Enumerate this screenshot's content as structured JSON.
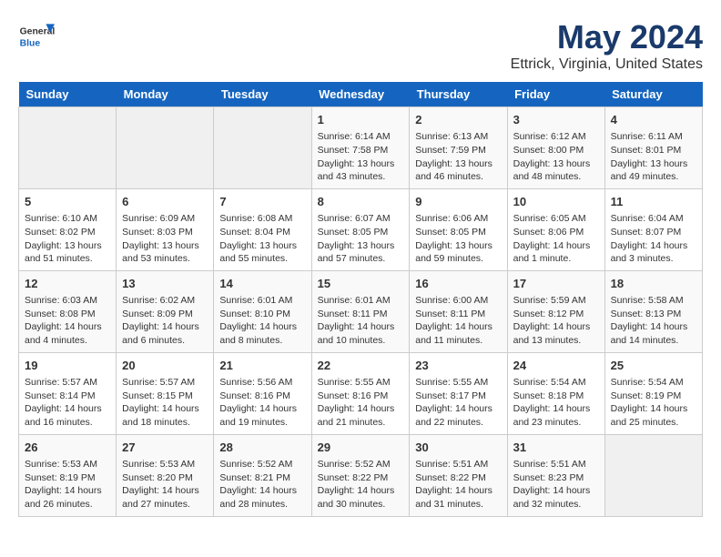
{
  "header": {
    "logo_general": "General",
    "logo_blue": "Blue",
    "month_year": "May 2024",
    "location": "Ettrick, Virginia, United States"
  },
  "days_of_week": [
    "Sunday",
    "Monday",
    "Tuesday",
    "Wednesday",
    "Thursday",
    "Friday",
    "Saturday"
  ],
  "weeks": [
    [
      {
        "day": "",
        "info": ""
      },
      {
        "day": "",
        "info": ""
      },
      {
        "day": "",
        "info": ""
      },
      {
        "day": "1",
        "info": "Sunrise: 6:14 AM\nSunset: 7:58 PM\nDaylight: 13 hours\nand 43 minutes."
      },
      {
        "day": "2",
        "info": "Sunrise: 6:13 AM\nSunset: 7:59 PM\nDaylight: 13 hours\nand 46 minutes."
      },
      {
        "day": "3",
        "info": "Sunrise: 6:12 AM\nSunset: 8:00 PM\nDaylight: 13 hours\nand 48 minutes."
      },
      {
        "day": "4",
        "info": "Sunrise: 6:11 AM\nSunset: 8:01 PM\nDaylight: 13 hours\nand 49 minutes."
      }
    ],
    [
      {
        "day": "5",
        "info": "Sunrise: 6:10 AM\nSunset: 8:02 PM\nDaylight: 13 hours\nand 51 minutes."
      },
      {
        "day": "6",
        "info": "Sunrise: 6:09 AM\nSunset: 8:03 PM\nDaylight: 13 hours\nand 53 minutes."
      },
      {
        "day": "7",
        "info": "Sunrise: 6:08 AM\nSunset: 8:04 PM\nDaylight: 13 hours\nand 55 minutes."
      },
      {
        "day": "8",
        "info": "Sunrise: 6:07 AM\nSunset: 8:05 PM\nDaylight: 13 hours\nand 57 minutes."
      },
      {
        "day": "9",
        "info": "Sunrise: 6:06 AM\nSunset: 8:05 PM\nDaylight: 13 hours\nand 59 minutes."
      },
      {
        "day": "10",
        "info": "Sunrise: 6:05 AM\nSunset: 8:06 PM\nDaylight: 14 hours\nand 1 minute."
      },
      {
        "day": "11",
        "info": "Sunrise: 6:04 AM\nSunset: 8:07 PM\nDaylight: 14 hours\nand 3 minutes."
      }
    ],
    [
      {
        "day": "12",
        "info": "Sunrise: 6:03 AM\nSunset: 8:08 PM\nDaylight: 14 hours\nand 4 minutes."
      },
      {
        "day": "13",
        "info": "Sunrise: 6:02 AM\nSunset: 8:09 PM\nDaylight: 14 hours\nand 6 minutes."
      },
      {
        "day": "14",
        "info": "Sunrise: 6:01 AM\nSunset: 8:10 PM\nDaylight: 14 hours\nand 8 minutes."
      },
      {
        "day": "15",
        "info": "Sunrise: 6:01 AM\nSunset: 8:11 PM\nDaylight: 14 hours\nand 10 minutes."
      },
      {
        "day": "16",
        "info": "Sunrise: 6:00 AM\nSunset: 8:11 PM\nDaylight: 14 hours\nand 11 minutes."
      },
      {
        "day": "17",
        "info": "Sunrise: 5:59 AM\nSunset: 8:12 PM\nDaylight: 14 hours\nand 13 minutes."
      },
      {
        "day": "18",
        "info": "Sunrise: 5:58 AM\nSunset: 8:13 PM\nDaylight: 14 hours\nand 14 minutes."
      }
    ],
    [
      {
        "day": "19",
        "info": "Sunrise: 5:57 AM\nSunset: 8:14 PM\nDaylight: 14 hours\nand 16 minutes."
      },
      {
        "day": "20",
        "info": "Sunrise: 5:57 AM\nSunset: 8:15 PM\nDaylight: 14 hours\nand 18 minutes."
      },
      {
        "day": "21",
        "info": "Sunrise: 5:56 AM\nSunset: 8:16 PM\nDaylight: 14 hours\nand 19 minutes."
      },
      {
        "day": "22",
        "info": "Sunrise: 5:55 AM\nSunset: 8:16 PM\nDaylight: 14 hours\nand 21 minutes."
      },
      {
        "day": "23",
        "info": "Sunrise: 5:55 AM\nSunset: 8:17 PM\nDaylight: 14 hours\nand 22 minutes."
      },
      {
        "day": "24",
        "info": "Sunrise: 5:54 AM\nSunset: 8:18 PM\nDaylight: 14 hours\nand 23 minutes."
      },
      {
        "day": "25",
        "info": "Sunrise: 5:54 AM\nSunset: 8:19 PM\nDaylight: 14 hours\nand 25 minutes."
      }
    ],
    [
      {
        "day": "26",
        "info": "Sunrise: 5:53 AM\nSunset: 8:19 PM\nDaylight: 14 hours\nand 26 minutes."
      },
      {
        "day": "27",
        "info": "Sunrise: 5:53 AM\nSunset: 8:20 PM\nDaylight: 14 hours\nand 27 minutes."
      },
      {
        "day": "28",
        "info": "Sunrise: 5:52 AM\nSunset: 8:21 PM\nDaylight: 14 hours\nand 28 minutes."
      },
      {
        "day": "29",
        "info": "Sunrise: 5:52 AM\nSunset: 8:22 PM\nDaylight: 14 hours\nand 30 minutes."
      },
      {
        "day": "30",
        "info": "Sunrise: 5:51 AM\nSunset: 8:22 PM\nDaylight: 14 hours\nand 31 minutes."
      },
      {
        "day": "31",
        "info": "Sunrise: 5:51 AM\nSunset: 8:23 PM\nDaylight: 14 hours\nand 32 minutes."
      },
      {
        "day": "",
        "info": ""
      }
    ]
  ]
}
